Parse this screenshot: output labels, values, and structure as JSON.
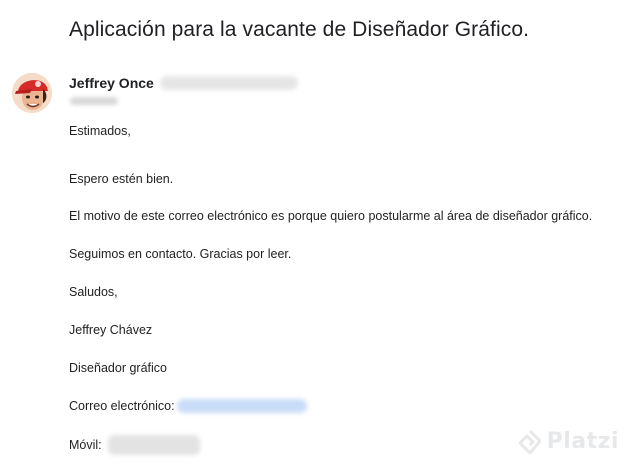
{
  "email": {
    "subject": "Aplicación para la vacante de Diseñador Gráfico.",
    "sender": {
      "name": "Jeffrey Once",
      "avatar": "user-avatar-red-cap"
    },
    "body": {
      "greeting": "Estimados,",
      "line1": "Espero estén bien.",
      "line2": "El motivo de este correo electrónico es porque quiero postularme al área de diseñador gráfico.",
      "line3": "Seguimos en contacto. Gracias por leer.",
      "closing": "Saludos,",
      "signature_name": "Jeffrey Chávez",
      "signature_title": "Diseñador gráfico",
      "email_label": "Correo electrónico:",
      "phone_label": "Móvil:"
    }
  },
  "watermark": {
    "text": "Platzi",
    "icon": "platzi-logo-icon"
  },
  "colors": {
    "link_blur": "#c9dcf7",
    "text": "#222222",
    "subject": "#202124"
  }
}
